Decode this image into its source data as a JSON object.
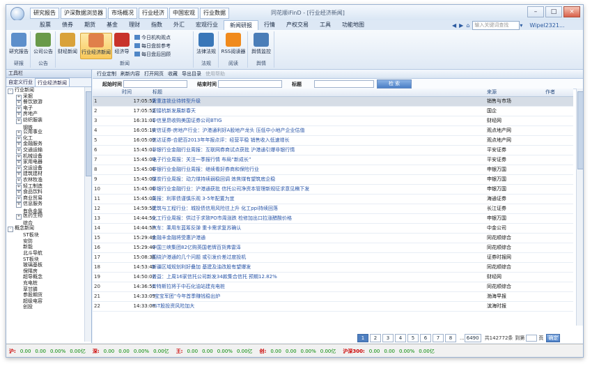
{
  "quick_tabs": [
    "研究报告",
    "沪深数据浏览器",
    "市场概况",
    "行业经济",
    "中国宏观",
    "行业数据"
  ],
  "app_title": "同花顺iFinD - [行业经济新闻]",
  "menu": [
    "股票",
    "债券",
    "期货",
    "基金",
    "理财",
    "指数",
    "外汇",
    "宏观行业",
    "新闻研报",
    "行情",
    "产权交易",
    "工具",
    "功能地图"
  ],
  "menu_active_index": 8,
  "search_placeholder": "输入关键词查找",
  "user": "Wipel2321...",
  "ribbon": {
    "buttons": [
      "研究报告",
      "公司公告",
      "财经新闻",
      "行业经济新闻",
      "经济导",
      "法律法规",
      "RSS阅读器",
      "舆情监控"
    ],
    "small_items": [
      "今日机构观点",
      "每日盘前参考",
      "每日盘后回顾"
    ],
    "groups": [
      "研报",
      "公告",
      "新闻",
      "法规",
      "阅读",
      "舆情"
    ]
  },
  "left_panel": {
    "title": "工具栏",
    "tabs": [
      "自定义行业",
      "行业经济新闻"
    ],
    "tree": [
      {
        "label": "行业新闻",
        "level": 0,
        "exp": "-"
      },
      {
        "label": "采掘",
        "level": 1,
        "exp": "+"
      },
      {
        "label": "餐饮旅游",
        "level": 1,
        "exp": "+"
      },
      {
        "label": "电子",
        "level": 1,
        "exp": "+"
      },
      {
        "label": "房地产",
        "level": 1,
        "exp": "+"
      },
      {
        "label": "纺织服装",
        "level": 1,
        "exp": "+"
      },
      {
        "label": "钢铁",
        "level": 1,
        "exp": ""
      },
      {
        "label": "公用事业",
        "level": 1,
        "exp": "+"
      },
      {
        "label": "化工",
        "level": 1,
        "exp": "+"
      },
      {
        "label": "金融服务",
        "level": 1,
        "exp": "+"
      },
      {
        "label": "交通运输",
        "level": 1,
        "exp": "+"
      },
      {
        "label": "机械设备",
        "level": 1,
        "exp": "+"
      },
      {
        "label": "家用电器",
        "level": 1,
        "exp": "+"
      },
      {
        "label": "交运设备",
        "level": 1,
        "exp": "+"
      },
      {
        "label": "建筑建材",
        "level": 1,
        "exp": "+"
      },
      {
        "label": "农林牧渔",
        "level": 1,
        "exp": "+"
      },
      {
        "label": "轻工制造",
        "level": 1,
        "exp": "+"
      },
      {
        "label": "食品饮料",
        "level": 1,
        "exp": "+"
      },
      {
        "label": "商业贸易",
        "level": 1,
        "exp": "+"
      },
      {
        "label": "信息服务",
        "level": 1,
        "exp": "+"
      },
      {
        "label": "有色金属",
        "level": 1,
        "exp": ""
      },
      {
        "label": "医药生物",
        "level": 1,
        "exp": "+"
      },
      {
        "label": "综合",
        "level": 1,
        "exp": ""
      },
      {
        "label": "概念新闻",
        "level": 0,
        "exp": "-"
      },
      {
        "label": "ST板块",
        "level": 1,
        "exp": ""
      },
      {
        "label": "安防",
        "level": 1,
        "exp": ""
      },
      {
        "label": "新能",
        "level": 1,
        "exp": ""
      },
      {
        "label": "北斗导航",
        "level": 1,
        "exp": ""
      },
      {
        "label": "ST板块",
        "level": 1,
        "exp": ""
      },
      {
        "label": "玻璃基板",
        "level": 1,
        "exp": ""
      },
      {
        "label": "保障房",
        "level": 1,
        "exp": ""
      },
      {
        "label": "超导概念",
        "level": 1,
        "exp": ""
      },
      {
        "label": "充电桩",
        "level": 1,
        "exp": ""
      },
      {
        "label": "草甘膦",
        "level": 1,
        "exp": ""
      },
      {
        "label": "参股期货",
        "level": 1,
        "exp": ""
      },
      {
        "label": "超级电容",
        "level": 1,
        "exp": ""
      },
      {
        "label": "创投",
        "level": 1,
        "exp": ""
      }
    ]
  },
  "toolbar": [
    "行业定制",
    "刷新内容",
    "打开网页",
    "收藏",
    "导出目录",
    "使用帮助"
  ],
  "filters": {
    "start_label": "起始时间",
    "end_label": "结束时间",
    "title_label": "标题",
    "search_button": "检 索"
  },
  "columns": {
    "time": "时间",
    "title": "标题",
    "source": "来源",
    "author": "作者"
  },
  "rows": [
    {
      "n": "1",
      "time": "17:05:52",
      "title": "需重连锁业待转型升级",
      "source": "销售与市场",
      "author": ""
    },
    {
      "n": "2",
      "time": "17:05:52",
      "title": "迎接杭新发展新春天",
      "source": "国企",
      "author": ""
    },
    {
      "n": "3",
      "time": "16:31:01",
      "title": "中信里昂收购美国证券公司BTIG",
      "source": "财经网",
      "author": ""
    },
    {
      "n": "4",
      "time": "16:05:10",
      "title": "安信证券-房地产行业：沪港通利好A股地产龙头 压低中小地产企业估值",
      "source": "观点地产网",
      "author": ""
    },
    {
      "n": "5",
      "time": "16:05:09",
      "title": "信达证券-合肥百2013年年报点评：经营平稳 销售收入低速增长",
      "source": "观点地产网",
      "author": ""
    },
    {
      "n": "6",
      "time": "15:45:01",
      "title": "非银行业金融行业周报：互联网券商试点获批 沪港通引爆非银行情",
      "source": "平安证券",
      "author": ""
    },
    {
      "n": "7",
      "time": "15:45:00",
      "title": "电子行业周报：关注一季报行情 布局“新成长”",
      "source": "平安证券",
      "author": ""
    },
    {
      "n": "8",
      "time": "15:45:00",
      "title": "非银行业金融行业周报：继续看好券商和保险行业",
      "source": "申银万国",
      "author": ""
    },
    {
      "n": "9",
      "time": "15:45:00",
      "title": "煤炭行业周报：动力煤持续弱稳回调 炼焦煤有望筑底企稳",
      "source": "申银万国",
      "author": ""
    },
    {
      "n": "10",
      "time": "15:45:00",
      "title": "非银行业金融行业：沪港通获批 信托公司净资本管理新规征求意见稿下发",
      "source": "申银万国",
      "author": ""
    },
    {
      "n": "11",
      "time": "15:45:00",
      "title": "周报：利率债谨慎乐观 3-5年配置为宜",
      "source": "海通证券",
      "author": ""
    },
    {
      "n": "12",
      "time": "14:59:59",
      "title": "建筑与工程行业：城投债信用风险往上升 化工ppi持续回落",
      "source": "长江证券",
      "author": ""
    },
    {
      "n": "13",
      "time": "14:44:59",
      "title": "化工行业周报：供过于求致PO市周涨跌 检修加出口拉涨醋酸价格",
      "source": "申银万国",
      "author": ""
    },
    {
      "n": "14",
      "time": "14:44:58",
      "title": "汽车：乘用车蓝筹反弹 重卡需求复苏确认",
      "source": "中金公司",
      "author": ""
    },
    {
      "n": "15",
      "time": "15:29:49",
      "title": "金融丰金融将受惠沪港通",
      "source": "同花顺综合",
      "author": ""
    },
    {
      "n": "16",
      "time": "15:29:49",
      "title": "中国三峡集团82亿购英国老牌百货弗雷泽",
      "source": "同花顺综合",
      "author": ""
    },
    {
      "n": "17",
      "time": "15:08:38",
      "title": "围绕沪港通的几个问题 或引发价差过度投机",
      "source": "证券时报网",
      "author": ""
    },
    {
      "n": "18",
      "time": "14:53:49",
      "title": "新疆区域规划利好叠加 基建及油改股有望爆发",
      "source": "同花顺综合",
      "author": ""
    },
    {
      "n": "19",
      "time": "14:50:07",
      "title": "普益：上周16家信托公司新发34款集合信托 预期12.82%",
      "source": "财经网",
      "author": ""
    },
    {
      "n": "20",
      "time": "14:36:51",
      "title": "传特斯拉将于中石化油站建充电桩",
      "source": "同花顺综合",
      "author": ""
    },
    {
      "n": "21",
      "time": "14:33:09",
      "title": "“宝宝军团”今年首季赚钱稳出炉",
      "source": "渤海早报",
      "author": ""
    },
    {
      "n": "22",
      "time": "14:33:08",
      "title": "*ST股投资风险加大",
      "source": "滨海时报",
      "author": ""
    }
  ],
  "pager": {
    "pages": [
      "1",
      "2",
      "3",
      "4",
      "5",
      "6",
      "7",
      "8"
    ],
    "last": "6490",
    "total": "共142772条",
    "goto_prefix": "到第",
    "goto_suffix": "页",
    "go": "确定"
  },
  "status": [
    {
      "label": "沪:",
      "a": "0.00",
      "b": "0.00",
      "c": "0.00%",
      "d": "0.00亿"
    },
    {
      "label": "深:",
      "a": "0.00",
      "b": "0.00",
      "c": "0.00%",
      "d": "0.00亿"
    },
    {
      "label": "王:",
      "a": "0.00",
      "b": "0.00",
      "c": "0.00%",
      "d": "0.00亿"
    },
    {
      "label": "创:",
      "a": "0.00",
      "b": "0.00",
      "c": "0.00%",
      "d": "0.00亿"
    },
    {
      "label": "沪深300:",
      "a": "0.00",
      "b": "0.00",
      "c": "0.00%",
      "d": "0.00亿"
    }
  ],
  "colors": {
    "accent": "#4f7fc0",
    "link": "#2855a8",
    "selected_row": "#d6dde6"
  }
}
